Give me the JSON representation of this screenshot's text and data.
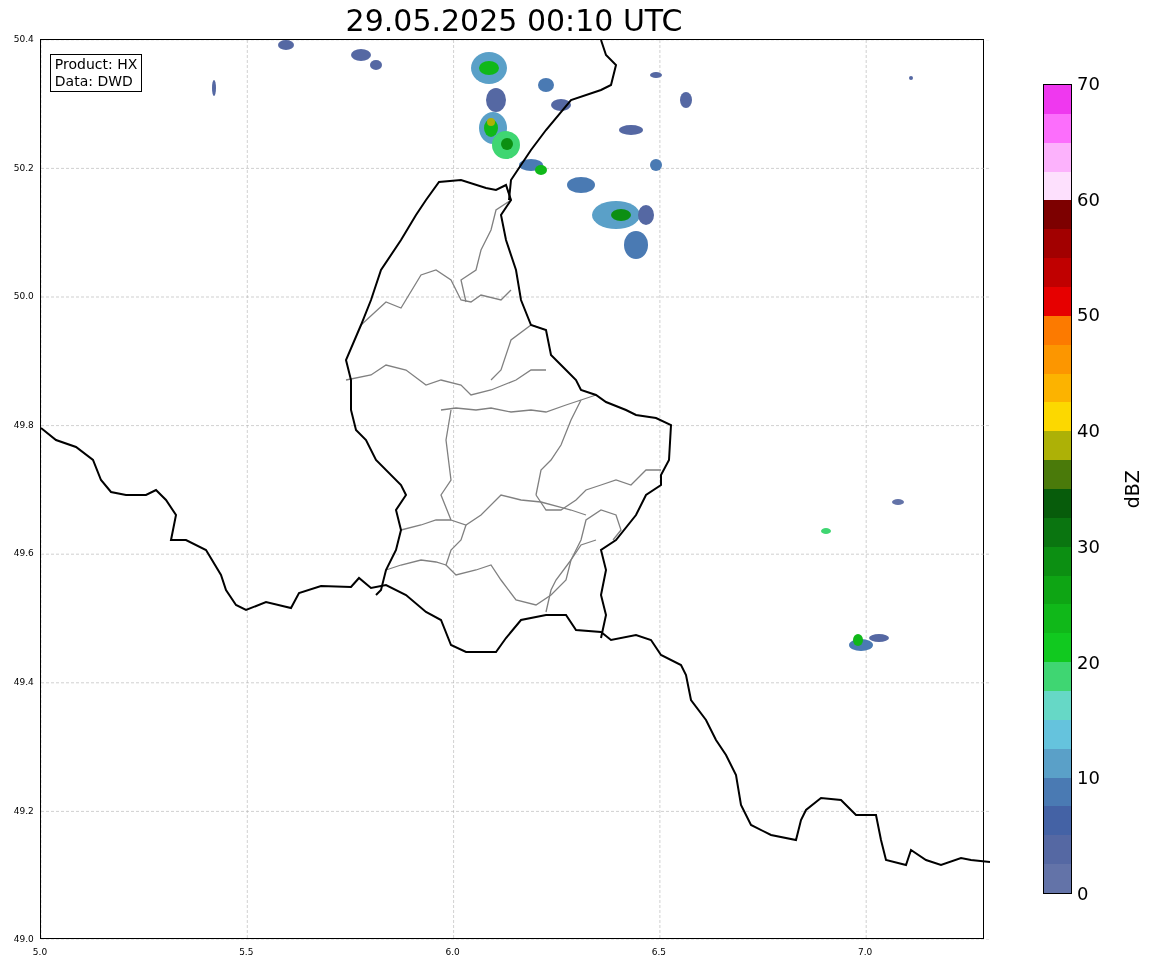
{
  "title": "29.05.2025 00:10 UTC",
  "legend": [
    "Product: HX",
    "Data: DWD"
  ],
  "map": {
    "xticks": [
      "5.0",
      "5.5",
      "6.0",
      "6.5",
      "7.0"
    ],
    "yticks": [
      "50.4",
      "50.2",
      "50.0",
      "49.8",
      "49.6",
      "49.4",
      "49.2",
      "49.0"
    ]
  },
  "colorbar": {
    "label": "dBZ",
    "ticks": [
      "70",
      "60",
      "50",
      "40",
      "30",
      "20",
      "10",
      "0"
    ],
    "segments": [
      {
        "color": "#6373a8"
      },
      {
        "color": "#5568a3"
      },
      {
        "color": "#4462a5"
      },
      {
        "color": "#4a7ab3"
      },
      {
        "color": "#5aa0c8"
      },
      {
        "color": "#65c3dd"
      },
      {
        "color": "#66d8c6"
      },
      {
        "color": "#3fd672"
      },
      {
        "color": "#11c91f"
      },
      {
        "color": "#10b819"
      },
      {
        "color": "#0ea514"
      },
      {
        "color": "#0c8f12"
      },
      {
        "color": "#0a7510"
      },
      {
        "color": "#075c0b"
      },
      {
        "color": "#4a7a0a"
      },
      {
        "color": "#adb106"
      },
      {
        "color": "#fcd800"
      },
      {
        "color": "#fcb300"
      },
      {
        "color": "#fc9600"
      },
      {
        "color": "#fc7a00"
      },
      {
        "color": "#e60000"
      },
      {
        "color": "#c00000"
      },
      {
        "color": "#a20000"
      },
      {
        "color": "#7d0000"
      },
      {
        "color": "#fde0fd"
      },
      {
        "color": "#fcb2fc"
      },
      {
        "color": "#fc6efc"
      },
      {
        "color": "#ef38ef"
      }
    ]
  }
}
